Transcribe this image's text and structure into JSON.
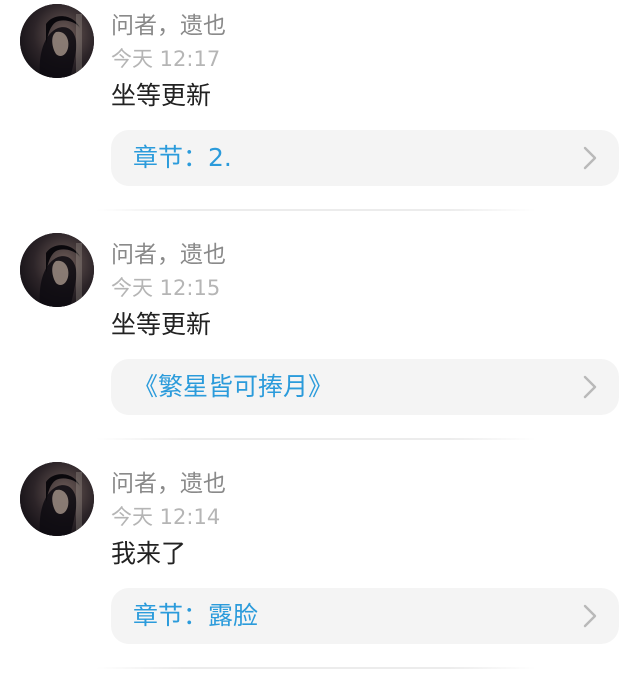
{
  "comments": [
    {
      "author": "问者，遗也",
      "time": "今天 12:17",
      "text": "坐等更新",
      "link": "章节：2."
    },
    {
      "author": "问者，遗也",
      "time": "今天 12:15",
      "text": "坐等更新",
      "link": "《繁星皆可捧月》"
    },
    {
      "author": "问者，遗也",
      "time": "今天 12:14",
      "text": "我来了",
      "link": "章节：露脸"
    }
  ],
  "icons": {
    "chevron": "chevron-right-icon",
    "avatar": "avatar"
  },
  "colors": {
    "link": "#2b9bdb",
    "author": "#8a8a8a",
    "time": "#b5b5b5",
    "card_bg": "#f4f4f4"
  }
}
